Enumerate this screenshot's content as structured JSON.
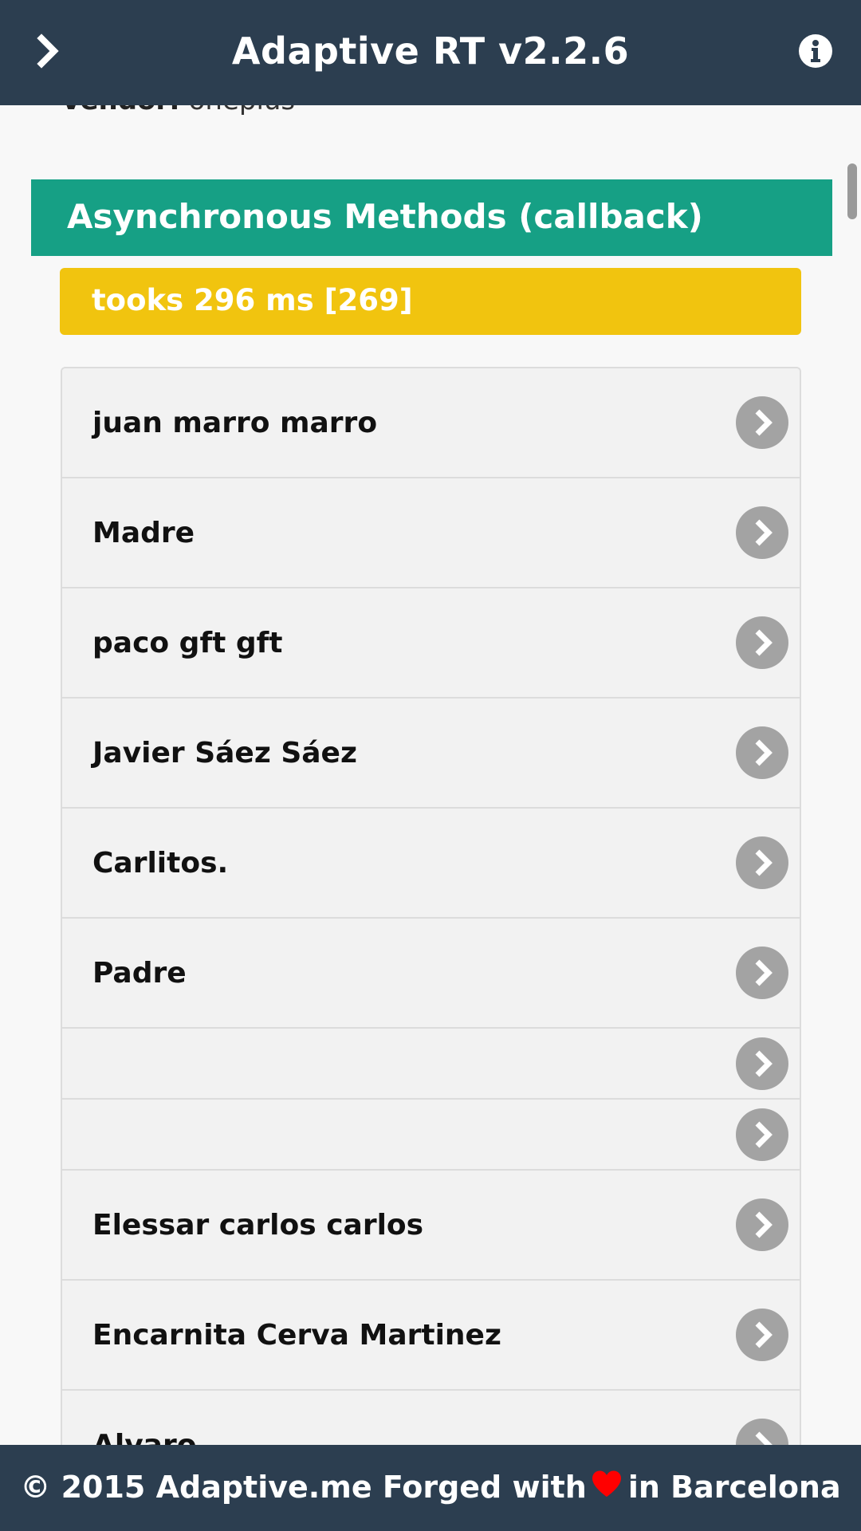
{
  "header": {
    "title": "Adaptive RT v2.2.6",
    "menu_icon": "chevron-right-icon",
    "info_icon": "info-icon"
  },
  "vendor": {
    "label": "Vendor:",
    "value": " oneplus"
  },
  "section": {
    "title": "Asynchronous Methods (callback)"
  },
  "timing": {
    "text": "tooks 296 ms [269]"
  },
  "contacts": [
    {
      "name": "juan marro marro"
    },
    {
      "name": "Madre"
    },
    {
      "name": "paco gft gft"
    },
    {
      "name": "Javier Sáez Sáez"
    },
    {
      "name": "Carlitos."
    },
    {
      "name": "Padre"
    },
    {
      "name": ""
    },
    {
      "name": ""
    },
    {
      "name": "Elessar carlos carlos"
    },
    {
      "name": "Encarnita Cerva Martinez"
    },
    {
      "name": "Alvaro"
    }
  ],
  "footer": {
    "text_before": "© 2015 Adaptive.me Forged with",
    "heart_icon": "heart-icon",
    "text_after": "in Barcelona"
  },
  "colors": {
    "header_bg": "#2c3e50",
    "section_bg": "#16a085",
    "badge_bg": "#f1c40f",
    "heart": "#ff0000",
    "chevron_bg": "#a3a3a3"
  }
}
